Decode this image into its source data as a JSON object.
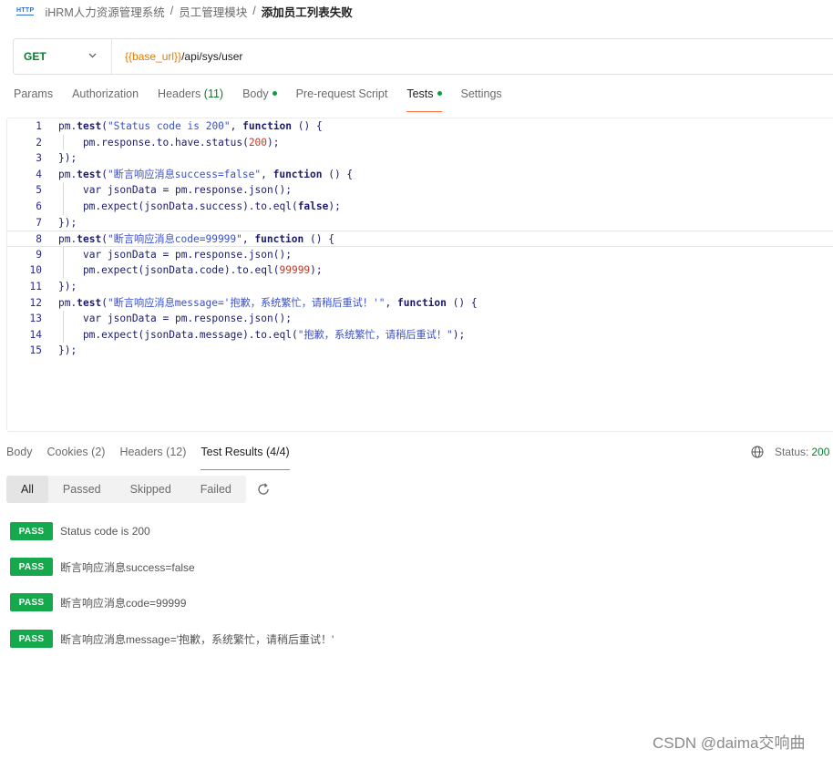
{
  "breadcrumb": {
    "icon": "http-icon",
    "icon_text": "HTTP",
    "items": [
      "iHRM人力资源管理系统",
      "员工管理模块"
    ],
    "separator": "/",
    "current": "添加员工列表失败"
  },
  "request": {
    "method": "GET",
    "url_variable": "{{base_url}}",
    "url_path": "/api/sys/user"
  },
  "request_tabs": [
    {
      "label": "Params"
    },
    {
      "label": "Authorization"
    },
    {
      "label": "Headers",
      "count": "(11)"
    },
    {
      "label": "Body",
      "dot": true
    },
    {
      "label": "Pre-request Script"
    },
    {
      "label": "Tests",
      "dot": true,
      "active": true
    },
    {
      "label": "Settings"
    }
  ],
  "editor": {
    "active_line": 8,
    "lines": [
      {
        "n": "1",
        "tokens": [
          [
            "t-obj",
            "pm"
          ],
          [
            "t-plain",
            "."
          ],
          [
            "t-kw",
            "test"
          ],
          [
            "t-plain",
            "("
          ],
          [
            "t-str",
            "\"Status code is 200\""
          ],
          [
            "t-plain",
            ", "
          ],
          [
            "t-kw",
            "function"
          ],
          [
            "t-plain",
            " () {"
          ]
        ]
      },
      {
        "n": "2",
        "tokens": [
          [
            "t-plain",
            "    pm.response.to.have.status("
          ],
          [
            "t-num",
            "200"
          ],
          [
            "t-plain",
            ");"
          ]
        ]
      },
      {
        "n": "3",
        "tokens": [
          [
            "t-plain",
            "});"
          ]
        ]
      },
      {
        "n": "4",
        "tokens": [
          [
            "t-obj",
            "pm"
          ],
          [
            "t-plain",
            "."
          ],
          [
            "t-kw",
            "test"
          ],
          [
            "t-plain",
            "("
          ],
          [
            "t-str",
            "\"断言响应消息success=false\""
          ],
          [
            "t-plain",
            ", "
          ],
          [
            "t-kw",
            "function"
          ],
          [
            "t-plain",
            " () {"
          ]
        ]
      },
      {
        "n": "5",
        "tokens": [
          [
            "t-plain",
            "    "
          ],
          [
            "t-fn",
            "var"
          ],
          [
            "t-plain",
            " jsonData = pm.response.json();"
          ]
        ]
      },
      {
        "n": "6",
        "tokens": [
          [
            "t-plain",
            "    pm.expect(jsonData.success).to.eql("
          ],
          [
            "t-kw",
            "false"
          ],
          [
            "t-plain",
            ");"
          ]
        ]
      },
      {
        "n": "7",
        "tokens": [
          [
            "t-plain",
            "});"
          ]
        ]
      },
      {
        "n": "8",
        "tokens": [
          [
            "t-obj",
            "pm"
          ],
          [
            "t-plain",
            "."
          ],
          [
            "t-kw",
            "test"
          ],
          [
            "t-plain",
            "("
          ],
          [
            "t-str",
            "\"断言响应消息code=99999\""
          ],
          [
            "t-plain",
            ", "
          ],
          [
            "t-kw",
            "function"
          ],
          [
            "t-plain",
            " () {"
          ]
        ]
      },
      {
        "n": "9",
        "tokens": [
          [
            "t-plain",
            "    "
          ],
          [
            "t-fn",
            "var"
          ],
          [
            "t-plain",
            " jsonData = pm.response.json();"
          ]
        ]
      },
      {
        "n": "10",
        "tokens": [
          [
            "t-plain",
            "    pm.expect(jsonData.code).to.eql("
          ],
          [
            "t-num",
            "99999"
          ],
          [
            "t-plain",
            ");"
          ]
        ]
      },
      {
        "n": "11",
        "tokens": [
          [
            "t-plain",
            "});"
          ]
        ]
      },
      {
        "n": "12",
        "tokens": [
          [
            "t-obj",
            "pm"
          ],
          [
            "t-plain",
            "."
          ],
          [
            "t-kw",
            "test"
          ],
          [
            "t-plain",
            "("
          ],
          [
            "t-str",
            "\"断言响应消息message='抱歉，系统繁忙，请稍后重试！'\""
          ],
          [
            "t-plain",
            ", "
          ],
          [
            "t-kw",
            "function"
          ],
          [
            "t-plain",
            " () {"
          ]
        ]
      },
      {
        "n": "13",
        "tokens": [
          [
            "t-plain",
            "    "
          ],
          [
            "t-fn",
            "var"
          ],
          [
            "t-plain",
            " jsonData = pm.response.json();"
          ]
        ]
      },
      {
        "n": "14",
        "tokens": [
          [
            "t-plain",
            "    pm.expect(jsonData.message).to.eql("
          ],
          [
            "t-str",
            "\"抱歉，系统繁忙，请稍后重试！\""
          ],
          [
            "t-plain",
            ");"
          ]
        ]
      },
      {
        "n": "15",
        "tokens": [
          [
            "t-plain",
            "});"
          ]
        ]
      }
    ]
  },
  "response_tabs": [
    {
      "label": "Body"
    },
    {
      "label": "Cookies",
      "count": "(2)"
    },
    {
      "label": "Headers",
      "count": "(12)"
    },
    {
      "label": "Test Results",
      "count": "(4/4)",
      "active": true
    }
  ],
  "status": {
    "label": "Status:",
    "value": "200"
  },
  "filters": [
    {
      "label": "All",
      "active": true
    },
    {
      "label": "Passed"
    },
    {
      "label": "Skipped"
    },
    {
      "label": "Failed"
    }
  ],
  "results": [
    {
      "badge": "PASS",
      "name": "Status code is 200"
    },
    {
      "badge": "PASS",
      "name": "断言响应消息success=false"
    },
    {
      "badge": "PASS",
      "name": "断言响应消息code=99999"
    },
    {
      "badge": "PASS",
      "name": "断言响应消息message='抱歉，系统繁忙，请稍后重试！'"
    }
  ],
  "colors": {
    "accent": "#ff6c37",
    "pass": "#15a84c",
    "method": "#0a7d2c",
    "url_variable": "#e07b00"
  },
  "watermark": "CSDN @daima交响曲"
}
